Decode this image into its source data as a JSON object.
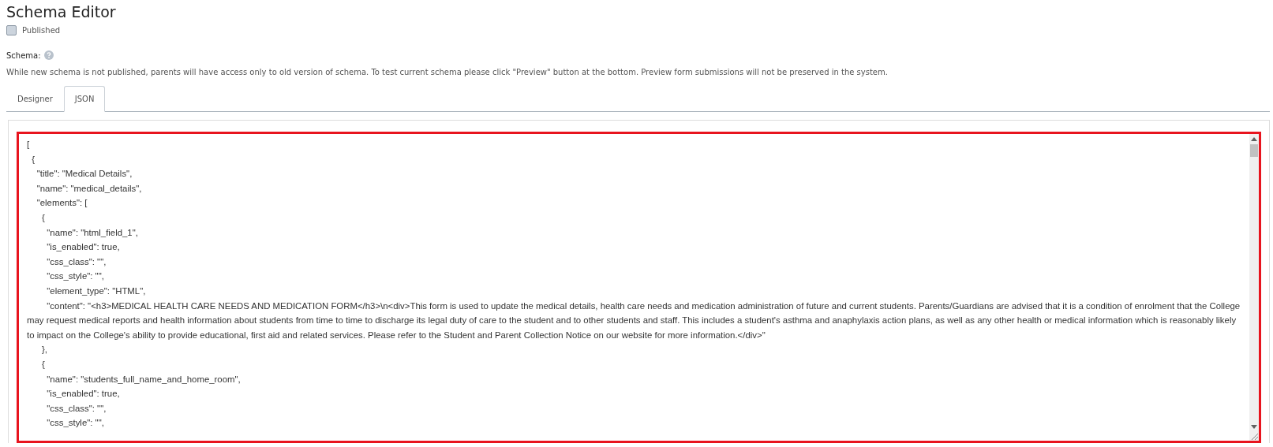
{
  "page_title": "Schema Editor",
  "published": {
    "label": "Published",
    "checked": false
  },
  "schema_label": "Schema:",
  "description": "While new schema is not published, parents will have access only to old version of schema. To test current schema please click \"Preview\" button at the bottom. Preview form submissions will not be preserved in the system.",
  "tabs": [
    {
      "label": "Designer",
      "selected": false
    },
    {
      "label": "JSON",
      "selected": true
    }
  ],
  "editor_lines": [
    "[",
    "  {",
    "    \"title\": \"Medical Details\",",
    "    \"name\": \"medical_details\",",
    "    \"elements\": [",
    "      {",
    "        \"name\": \"html_field_1\",",
    "        \"is_enabled\": true,",
    "        \"css_class\": \"\",",
    "        \"css_style\": \"\",",
    "        \"element_type\": \"HTML\",",
    "        \"content\": \"<h3>MEDICAL HEALTH CARE NEEDS AND MEDICATION FORM</h3>\\n<div>This form is used to update the medical details, health care needs and medication administration of future and current students. Parents/Guardians are advised that it is a condition of enrolment that the College may request medical reports and health information about students from time to time to discharge its legal duty of care to the student and to other students and staff. This includes a student's asthma and anaphylaxis action plans, as well as any other health or medical information which is reasonably likely to impact on the College's ability to provide educational, first aid and related services. Please refer to the Student and Parent Collection Notice on our website for more information.</div>\"",
    "      },",
    "      {",
    "        \"name\": \"students_full_name_and_home_room\",",
    "        \"is_enabled\": true,",
    "        \"css_class\": \"\",",
    "        \"css_style\": \"\","
  ]
}
